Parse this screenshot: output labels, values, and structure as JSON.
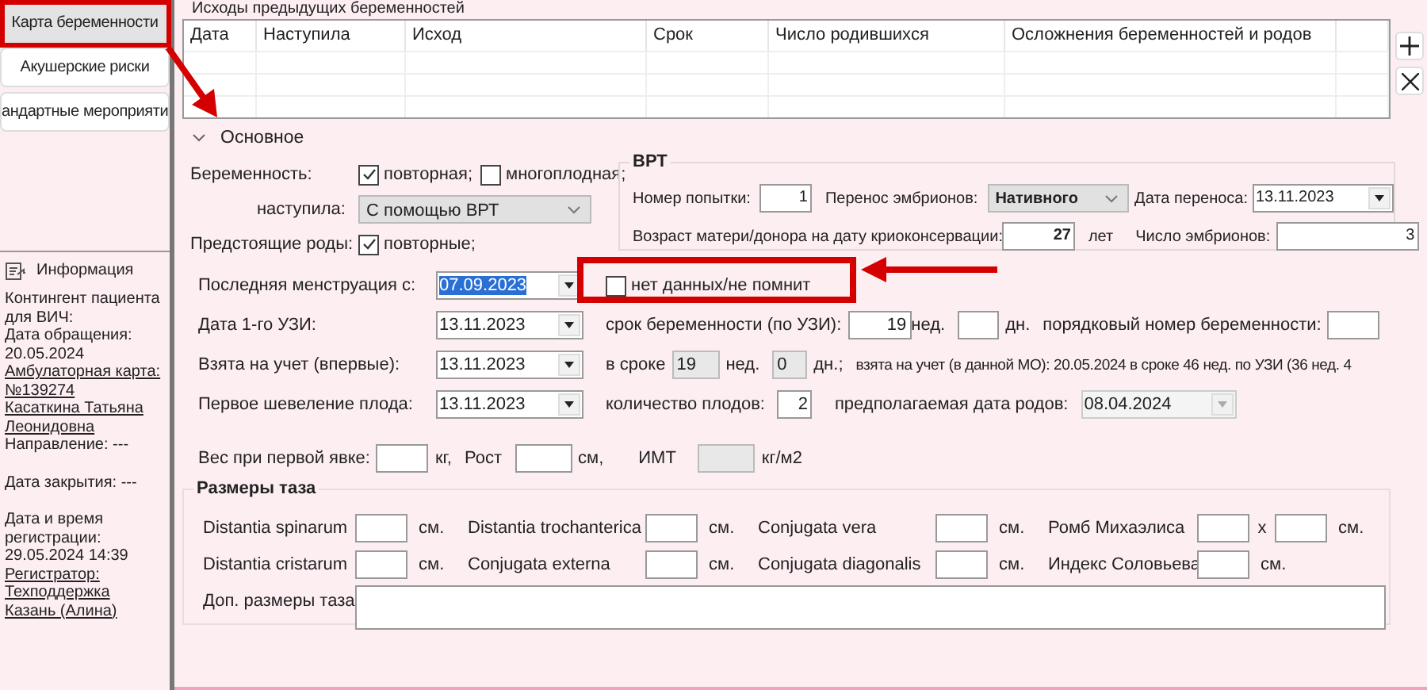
{
  "tabs": [
    {
      "label": "Карта беременности",
      "selected": true
    },
    {
      "label": "Акушерские риски",
      "selected": false
    },
    {
      "label": "андартные мероприяти",
      "selected": false
    }
  ],
  "info": {
    "title": "Информация",
    "groups": [
      [
        {
          "text": "Контингент пациента для ВИЧ:",
          "kind": "text"
        },
        {
          "text": "Дата обращения: 20.05.2024",
          "kind": "text"
        },
        {
          "text": "Амбулаторная карта: №139274",
          "kind": "link"
        },
        {
          "text": "Касаткина Татьяна Леонидовна",
          "kind": "link"
        },
        {
          "text": "Направление: ---",
          "kind": "text"
        }
      ],
      [
        {
          "text": "Дата закрытия: ---",
          "kind": "text"
        }
      ],
      [
        {
          "text": "Дата и время регистрации: 29.05.2024 14:39",
          "kind": "text"
        },
        {
          "text": "Регистратор: Техподдержка Казань (Алина)",
          "kind": "link"
        }
      ]
    ]
  },
  "previous_pregnancies": {
    "title": "Исходы предыдущих беременностей",
    "columns": [
      "Дата",
      "Наступила",
      "Исход",
      "Срок",
      "Число родившихся",
      "Осложнения беременностей и родов"
    ]
  },
  "section": {
    "title": "Основное",
    "expanded": true
  },
  "pregnancy": {
    "label": "Беременность:",
    "options": [
      {
        "label": "повторная;",
        "checked": true
      },
      {
        "label": "многоплодная;",
        "checked": false
      }
    ]
  },
  "onset": {
    "label": "наступила:",
    "value": "С помощью ВРТ"
  },
  "upcoming_birth": {
    "label": "Предстоящие роды:",
    "option": "повторные;",
    "checked": true
  },
  "vrt": {
    "title": "ВРТ",
    "attempt": {
      "label": "Номер попытки:",
      "value": "1"
    },
    "transfer": {
      "label": "Перенос эмбрионов:",
      "value": "Нативного"
    },
    "transfer_date": {
      "label": "Дата переноса:",
      "value": "13.11.2023"
    },
    "donor_age": {
      "label": "Возраст матери/донора на дату криоконсервации:",
      "value": "27",
      "unit": "лет"
    },
    "embryos": {
      "label": "Число эмбрионов:",
      "value": "3"
    }
  },
  "last_period": {
    "label": "Последняя менструация с:",
    "value": "07.09.2023",
    "highlighted": true
  },
  "no_data": {
    "label": "нет данных/не помнит",
    "checked": false
  },
  "first_us": {
    "label": "Дата 1-го УЗИ:",
    "value": "13.11.2023"
  },
  "term_us": {
    "label": "срок беременности (по УЗИ):",
    "weeks": "19",
    "weeks_unit": "нед.",
    "days_unit": "дн."
  },
  "order": {
    "label": "порядковый номер беременности:"
  },
  "registered": {
    "label": "Взята на учет (впервые):",
    "value": "13.11.2023"
  },
  "in_term": {
    "label": "в сроке",
    "weeks": "19",
    "weeks_unit": "нед.",
    "days": "0",
    "days_unit": "дн.;",
    "disabled": true
  },
  "registered_here": "взята на учет (в данной МО): 20.05.2024 в сроке 46 нед. по УЗИ (36 нед. 4",
  "movement": {
    "label": "Первое шевеление плода:",
    "value": "13.11.2023"
  },
  "fetus_count": {
    "label": "количество плодов:",
    "value": "2"
  },
  "due_date": {
    "label": "предполагаемая дата родов:",
    "value": "08.04.2024",
    "disabled": true
  },
  "anthropometry": {
    "weight_label": "Вес при первой явке:",
    "weight_unit": "кг,",
    "height_label": "Рост",
    "height_unit": "см,",
    "bmi_label": "ИМТ",
    "bmi_unit": "кг/м2"
  },
  "pelvis": {
    "title": "Размеры таза",
    "rows": [
      [
        {
          "label": "Distantia spinarum",
          "unit": "см."
        },
        {
          "label": "Distantia trochanterica",
          "unit": "см."
        },
        {
          "label": "Conjugata vera",
          "unit": "см."
        },
        {
          "label": "Ромб Михаэлиса",
          "separator": "x",
          "unit": "см."
        }
      ],
      [
        {
          "label": "Distantia cristarum",
          "unit": "см."
        },
        {
          "label": "Conjugata externa",
          "unit": "см."
        },
        {
          "label": "Conjugata diagonalis",
          "unit": "см."
        },
        {
          "label": "Индекс Соловьева",
          "unit": "см."
        }
      ]
    ],
    "extra_label": "Доп. размеры таза"
  }
}
